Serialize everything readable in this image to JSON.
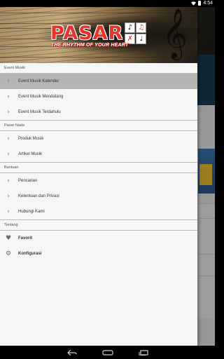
{
  "status": {
    "time": "4:54"
  },
  "drawer": {
    "logo": {
      "word": "PASAR",
      "tagline": "THE RHYTHM OF YOUR HEART"
    },
    "sections": [
      {
        "title": "Event Musik",
        "items": [
          {
            "label": "Event Musik Kalender",
            "selected": true
          },
          {
            "label": "Event Musik Mendatang"
          },
          {
            "label": "Event Musik Terdahulu"
          }
        ]
      },
      {
        "title": "Pasar Nada",
        "items": [
          {
            "label": "Produk Musik"
          },
          {
            "label": "Artikel Musik"
          }
        ]
      },
      {
        "title": "Bantuan",
        "items": [
          {
            "label": "Pencarian"
          },
          {
            "label": "Ketentuan dan Privasi"
          },
          {
            "label": "Hubungi Kami"
          }
        ]
      },
      {
        "title": "Tentang",
        "items": [
          {
            "label": "Favorit",
            "icon": "heart-icon"
          },
          {
            "label": "Konfigurasi",
            "icon": "gear-icon"
          }
        ]
      }
    ]
  },
  "navbar": {
    "back": "back-icon",
    "home": "home-icon",
    "recents": "recents-icon"
  }
}
